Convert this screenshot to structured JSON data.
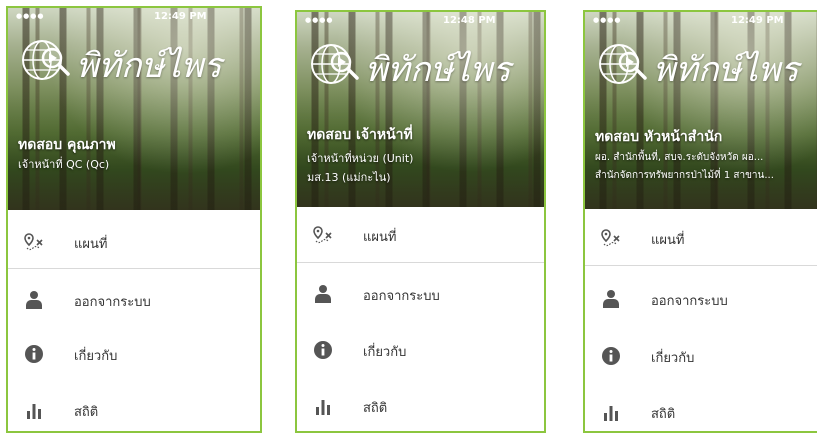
{
  "app": {
    "logo_text": "พิทักษ์ไพร"
  },
  "colors": {
    "frame_border": "#8cc63f",
    "menu_text": "#333333",
    "icon": "#555555"
  },
  "menu": {
    "map_label": "แผนที่",
    "logout_label": "ออกจากระบบ",
    "about_label": "เกี่ยวกับ",
    "stats_label": "สถิติ"
  },
  "screens": [
    {
      "time": "12:49 PM",
      "user": {
        "name": "ทดสอบ คุณภาพ",
        "line1": "เจ้าหน้าที่ QC (Qc)",
        "line2": ""
      }
    },
    {
      "time": "12:48 PM",
      "user": {
        "name": "ทดสอบ เจ้าหน้าที่",
        "line1": "เจ้าหน้าที่หน่วย (Unit)",
        "line2": "มส.13 (แม่กะไน)"
      }
    },
    {
      "time": "12:49 PM",
      "user": {
        "name": "ทดสอบ หัวหน้าสำนัก",
        "line1": "ผอ. สำนักพื้นที่, สบจ.ระดับจังหวัด ผอ...",
        "line2": "สำนักจัดการทรัพยากรป่าไม้ที่ 1 สาขาน..."
      }
    }
  ]
}
